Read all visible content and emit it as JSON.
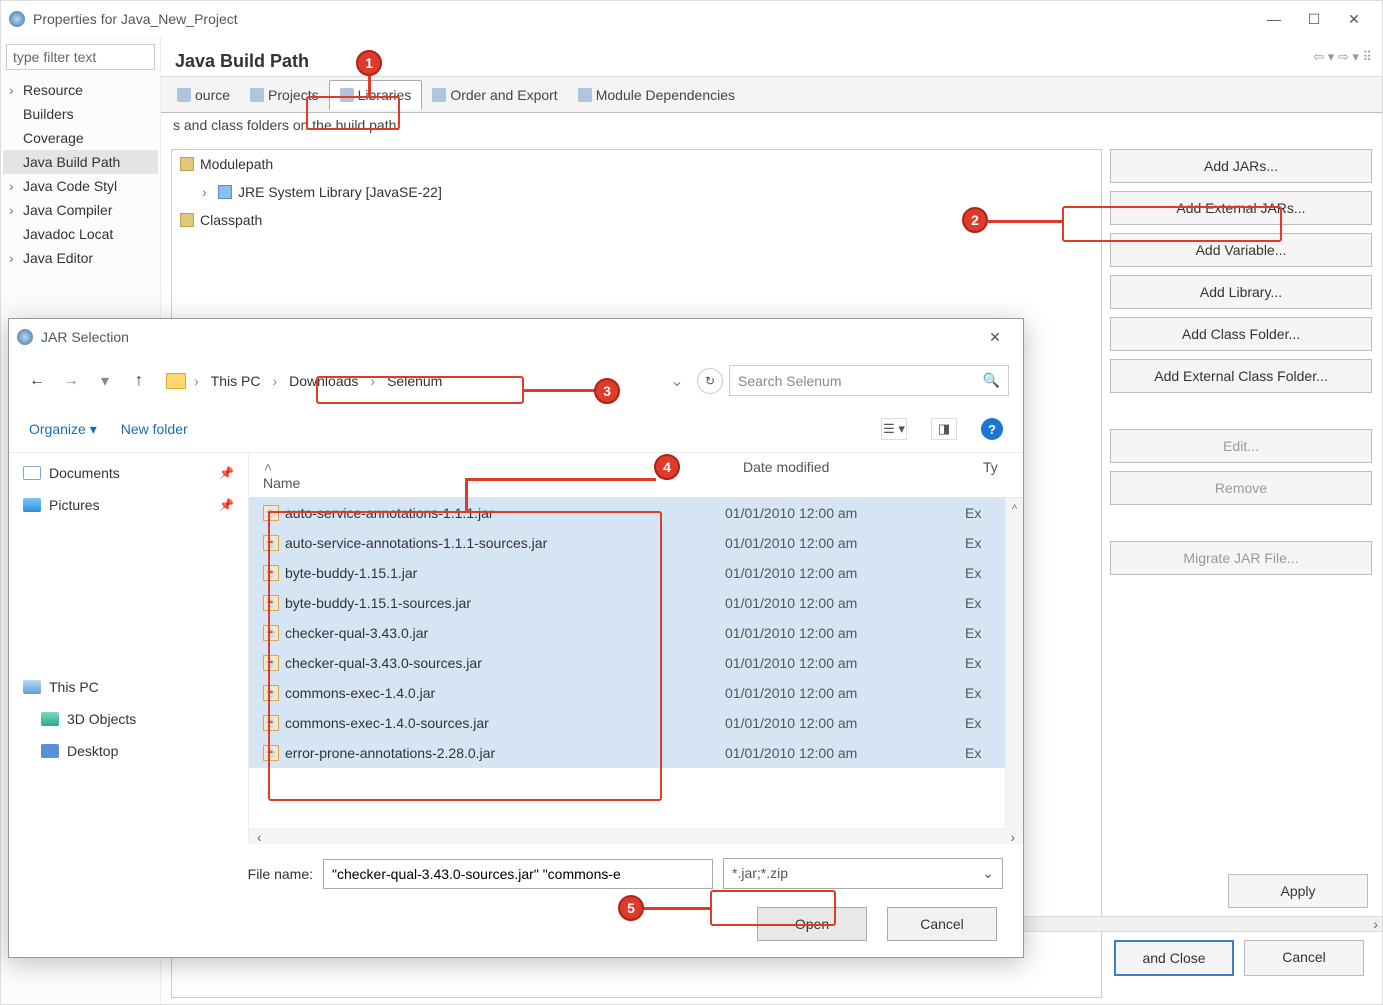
{
  "window": {
    "title": "Properties for Java_New_Project"
  },
  "filter": {
    "placeholder": "type filter text"
  },
  "tree": {
    "items": [
      {
        "label": "Resource",
        "expand": true
      },
      {
        "label": "Builders",
        "expand": false
      },
      {
        "label": "Coverage",
        "expand": false
      },
      {
        "label": "Java Build Path",
        "expand": false,
        "selected": true
      },
      {
        "label": "Java Code Styl",
        "expand": true
      },
      {
        "label": "Java Compiler",
        "expand": true
      },
      {
        "label": "Javadoc Locat",
        "expand": false
      },
      {
        "label": "Java Editor",
        "expand": true
      }
    ]
  },
  "page": {
    "title": "Java Build Path",
    "desc": "s and class folders on the build path:",
    "tabs": [
      "ource",
      "Projects",
      "Libraries",
      "Order and Export",
      "Module Dependencies"
    ],
    "active_tab": 2,
    "buildtree": {
      "modulepath": "Modulepath",
      "jre": "JRE System Library [JavaSE-22]",
      "classpath": "Classpath"
    },
    "buttons": {
      "addjars": "Add JARs...",
      "addext": "Add External JARs...",
      "addvar": "Add Variable...",
      "addlib": "Add Library...",
      "addclass": "Add Class Folder...",
      "addextclass": "Add External Class Folder...",
      "edit": "Edit...",
      "remove": "Remove",
      "migrate": "Migrate JAR File..."
    },
    "bottom": {
      "apply": "Apply",
      "applyclose": "and Close",
      "cancel": "Cancel"
    }
  },
  "dialog": {
    "title": "JAR Selection",
    "breadcrumb": [
      "This PC",
      "Downloads",
      "Selenum"
    ],
    "search_placeholder": "Search Selenum",
    "organize": "Organize",
    "newfolder": "New folder",
    "leftnav": [
      {
        "label": "Documents",
        "pin": true,
        "ic": "doc"
      },
      {
        "label": "Pictures",
        "pin": true,
        "ic": "pic"
      },
      {
        "label": "",
        "pin": false,
        "ic": "",
        "blur": true
      },
      {
        "label": "",
        "pin": false,
        "ic": "",
        "blur": true
      },
      {
        "label": "",
        "pin": false,
        "ic": "",
        "blur": true
      },
      {
        "label": "",
        "pin": false,
        "ic": "",
        "blur": true
      },
      {
        "label": "This PC",
        "pin": false,
        "ic": "pc",
        "spacer": true
      },
      {
        "label": "3D Objects",
        "pin": false,
        "ic": "obj",
        "indent": true
      },
      {
        "label": "Desktop",
        "pin": false,
        "ic": "desk",
        "indent": true
      }
    ],
    "cols": {
      "name": "Name",
      "date": "Date modified",
      "type": "Ty"
    },
    "files": [
      {
        "name": "auto-service-annotations-1.1.1.jar",
        "date": "01/01/2010 12:00 am",
        "type": "Ex",
        "sel": true
      },
      {
        "name": "auto-service-annotations-1.1.1-sources.jar",
        "date": "01/01/2010 12:00 am",
        "type": "Ex",
        "sel": true
      },
      {
        "name": "byte-buddy-1.15.1.jar",
        "date": "01/01/2010 12:00 am",
        "type": "Ex",
        "sel": true
      },
      {
        "name": "byte-buddy-1.15.1-sources.jar",
        "date": "01/01/2010 12:00 am",
        "type": "Ex",
        "sel": true
      },
      {
        "name": "checker-qual-3.43.0.jar",
        "date": "01/01/2010 12:00 am",
        "type": "Ex",
        "sel": true
      },
      {
        "name": "checker-qual-3.43.0-sources.jar",
        "date": "01/01/2010 12:00 am",
        "type": "Ex",
        "sel": true
      },
      {
        "name": "commons-exec-1.4.0.jar",
        "date": "01/01/2010 12:00 am",
        "type": "Ex",
        "sel": true
      },
      {
        "name": "commons-exec-1.4.0-sources.jar",
        "date": "01/01/2010 12:00 am",
        "type": "Ex",
        "sel": true
      },
      {
        "name": "error-prone-annotations-2.28.0.jar",
        "date": "01/01/2010 12:00 am",
        "type": "Ex",
        "sel": true
      }
    ],
    "filename_label": "File name:",
    "filename_value": "\"checker-qual-3.43.0-sources.jar\" \"commons-e",
    "ext_value": "*.jar;*.zip",
    "open": "Open",
    "cancel": "Cancel"
  },
  "markers": {
    "m1": "1",
    "m2": "2",
    "m3": "3",
    "m4": "4",
    "m5": "5"
  }
}
